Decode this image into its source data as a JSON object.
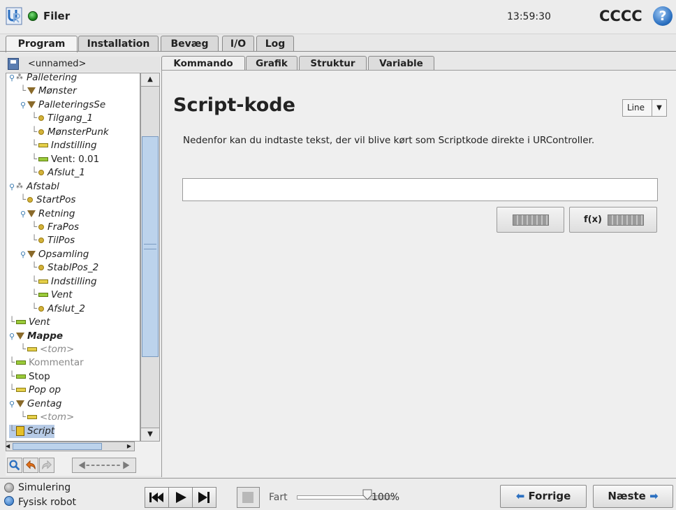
{
  "header": {
    "app_title": "Filer",
    "clock": "13:59:30",
    "robot_name": "CCCC",
    "help_glyph": "?"
  },
  "main_tabs": [
    "Program",
    "Installation",
    "Bevæg",
    "I/O",
    "Log"
  ],
  "program": {
    "name": "<unnamed>",
    "tree": [
      {
        "label": "Palletering",
        "icon": "pallet-icon",
        "indent": 0
      },
      {
        "label": "Mønster",
        "icon": "triangle-folder-icon",
        "indent": 1
      },
      {
        "label": "PalleteringsSe",
        "icon": "triangle-folder-icon",
        "indent": 1
      },
      {
        "label": "Tilgang_1",
        "icon": "waypoint-icon",
        "indent": 2
      },
      {
        "label": "MønsterPunk",
        "icon": "waypoint-icon",
        "indent": 2
      },
      {
        "label": "Indstilling",
        "icon": "set-icon",
        "indent": 2
      },
      {
        "label": "Vent: 0.01",
        "icon": "wait-icon",
        "indent": 2
      },
      {
        "label": "Afslut_1",
        "icon": "waypoint-icon",
        "indent": 2
      },
      {
        "label": "Afstabl",
        "icon": "pallet-icon",
        "indent": 0
      },
      {
        "label": "StartPos",
        "icon": "waypoint-icon",
        "indent": 1
      },
      {
        "label": "Retning",
        "icon": "triangle-folder-icon",
        "indent": 1
      },
      {
        "label": "FraPos",
        "icon": "waypoint-icon",
        "indent": 2
      },
      {
        "label": "TilPos",
        "icon": "waypoint-icon",
        "indent": 2
      },
      {
        "label": "Opsamling",
        "icon": "triangle-folder-icon",
        "indent": 1
      },
      {
        "label": "StablPos_2",
        "icon": "waypoint-icon",
        "indent": 2
      },
      {
        "label": "Indstilling",
        "icon": "set-icon",
        "indent": 2
      },
      {
        "label": "Vent",
        "icon": "wait-icon",
        "indent": 2
      },
      {
        "label": "Afslut_2",
        "icon": "waypoint-icon",
        "indent": 2
      },
      {
        "label": "Vent",
        "icon": "wait-icon",
        "indent": 0
      },
      {
        "label": "Mappe",
        "icon": "triangle-folder-icon",
        "indent": 0
      },
      {
        "label": "<tom>",
        "icon": "empty-icon",
        "indent": 1
      },
      {
        "label": "Kommentar",
        "icon": "comment-icon",
        "indent": 0
      },
      {
        "label": "Stop",
        "icon": "stop-icon",
        "indent": 0
      },
      {
        "label": "Pop op",
        "icon": "popup-icon",
        "indent": 0
      },
      {
        "label": "Gentag",
        "icon": "triangle-folder-icon",
        "indent": 0
      },
      {
        "label": "<tom>",
        "icon": "empty-icon",
        "indent": 1
      },
      {
        "label": "Script",
        "icon": "script-icon",
        "indent": 0
      }
    ]
  },
  "sub_tabs": [
    "Kommando",
    "Grafik",
    "Struktur",
    "Variable"
  ],
  "command": {
    "title": "Script-kode",
    "mode_select": "Line",
    "description": "Nedenfor kan du indtaste tekst, der vil blive kørt som Scriptkode direkte i URController.",
    "script_value": "",
    "fx_label": "f(x)"
  },
  "bottom": {
    "simulation_label": "Simulering",
    "real_robot_label": "Fysisk robot",
    "speed_label": "Fart",
    "speed_value": "100%",
    "prev_label": "Forrige",
    "next_label": "Næste"
  },
  "colors": {
    "accent_blue": "#2a6fc0",
    "selection": "#b7cbe6",
    "status_green": "#1f8a1f"
  }
}
